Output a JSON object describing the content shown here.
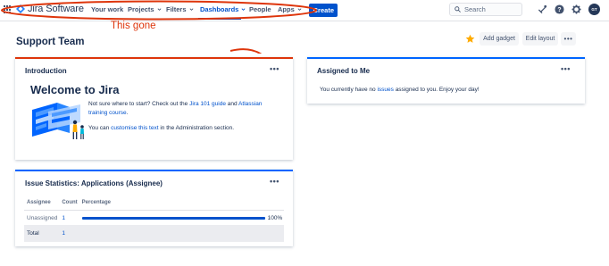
{
  "nav": {
    "logo_text": "Jira Software",
    "items": [
      {
        "label": "Your work"
      },
      {
        "label": "Projects"
      },
      {
        "label": "Filters"
      },
      {
        "label": "Dashboards"
      },
      {
        "label": "People"
      },
      {
        "label": "Apps"
      }
    ],
    "create_label": "Create",
    "search_placeholder": "Search",
    "avatar_initials": "GT"
  },
  "annotation": {
    "text": "This gone",
    "color": "#de350b"
  },
  "page": {
    "title": "Support Team",
    "add_gadget_label": "Add gadget",
    "edit_layout_label": "Edit layout",
    "more_label": "•••"
  },
  "intro": {
    "title": "Introduction",
    "more": "•••",
    "welcome": "Welcome to Jira",
    "p1_a": "Not sure where to start? Check out the ",
    "p1_link1": "Jira 101 guide",
    "p1_b": " and ",
    "p1_link2": "Atlassian training course",
    "p1_c": ".",
    "p2_a": "You can ",
    "p2_link": "customise this text",
    "p2_b": " in the Administration section."
  },
  "assigned": {
    "title": "Assigned to Me",
    "more": "•••",
    "msg_a": "You currently have no ",
    "msg_link": "issues",
    "msg_b": " assigned to you. Enjoy your day!"
  },
  "stats": {
    "title": "Issue Statistics: Applications (Assignee)",
    "more": "•••",
    "columns": [
      "Assignee",
      "Count",
      "Percentage"
    ],
    "rows": [
      {
        "assignee": "Unassigned",
        "count": "1",
        "percentage": 100,
        "percentage_label": "100%"
      }
    ],
    "total_label": "Total",
    "total_count": "1"
  },
  "colors": {
    "accent": "#0052cc",
    "annotation_red": "#de350b"
  }
}
